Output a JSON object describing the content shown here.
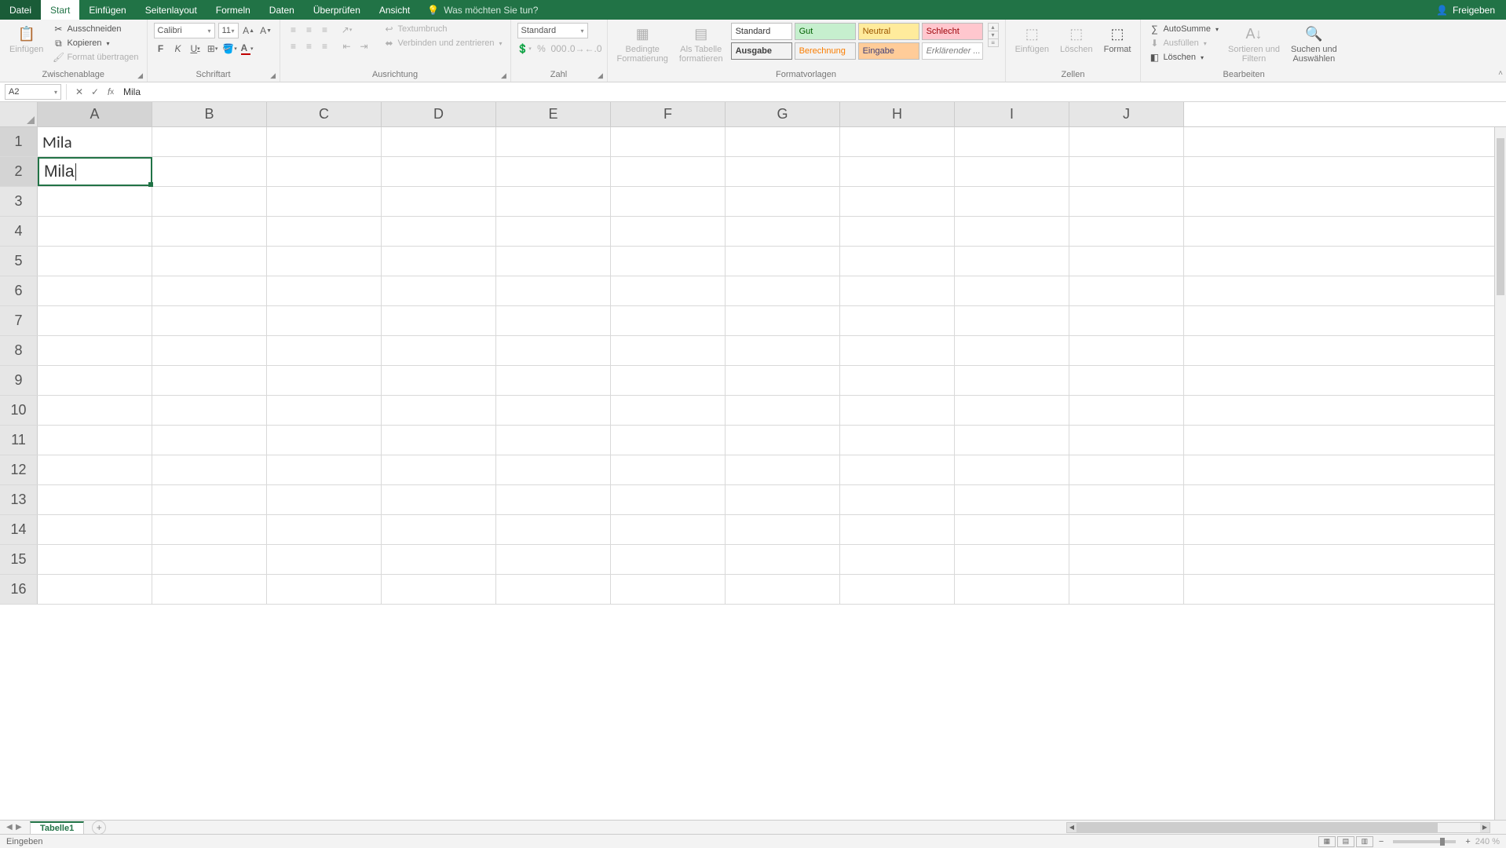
{
  "tabs": {
    "file": "Datei",
    "start": "Start",
    "einfuegen": "Einfügen",
    "seitenlayout": "Seitenlayout",
    "formeln": "Formeln",
    "daten": "Daten",
    "ueberpruefen": "Überprüfen",
    "ansicht": "Ansicht",
    "tellme": "Was möchten Sie tun?",
    "freigeben": "Freigeben"
  },
  "ribbon": {
    "clipboard": {
      "label": "Zwischenablage",
      "einfuegen": "Einfügen",
      "ausschneiden": "Ausschneiden",
      "kopieren": "Kopieren",
      "format_uebertragen": "Format übertragen"
    },
    "font": {
      "label": "Schriftart",
      "name": "Calibri",
      "size": "11"
    },
    "alignment": {
      "label": "Ausrichtung",
      "textumbruch": "Textumbruch",
      "verbinden": "Verbinden und zentrieren"
    },
    "number": {
      "label": "Zahl",
      "format": "Standard"
    },
    "styles": {
      "label": "Formatvorlagen",
      "bedingte": "Bedingte\nFormatierung",
      "als_tabelle": "Als Tabelle\nformatieren",
      "standard": "Standard",
      "gut": "Gut",
      "neutral": "Neutral",
      "schlecht": "Schlecht",
      "ausgabe": "Ausgabe",
      "berechnung": "Berechnung",
      "eingabe": "Eingabe",
      "erklaerender": "Erklärender ..."
    },
    "cells": {
      "label": "Zellen",
      "einfuegen": "Einfügen",
      "loeschen": "Löschen",
      "format": "Format"
    },
    "editing": {
      "label": "Bearbeiten",
      "autosumme": "AutoSumme",
      "ausfuellen": "Ausfüllen",
      "loeschen": "Löschen",
      "sortieren": "Sortieren und\nFiltern",
      "suchen": "Suchen und\nAuswählen"
    }
  },
  "formula_bar": {
    "name_box": "A2",
    "value": "Mila"
  },
  "grid": {
    "columns": [
      "A",
      "B",
      "C",
      "D",
      "E",
      "F",
      "G",
      "H",
      "I",
      "J"
    ],
    "rows": [
      "1",
      "2",
      "3",
      "4",
      "5",
      "6",
      "7",
      "8",
      "9",
      "10",
      "11",
      "12",
      "13",
      "14",
      "15",
      "16"
    ],
    "active_col": "A",
    "active_row_1": "1",
    "active_row_2": "2",
    "a1": "Mila",
    "a2": "Mila"
  },
  "sheet_tabs": {
    "tab1": "Tabelle1"
  },
  "status": {
    "mode": "Eingeben",
    "zoom": "240 %"
  }
}
